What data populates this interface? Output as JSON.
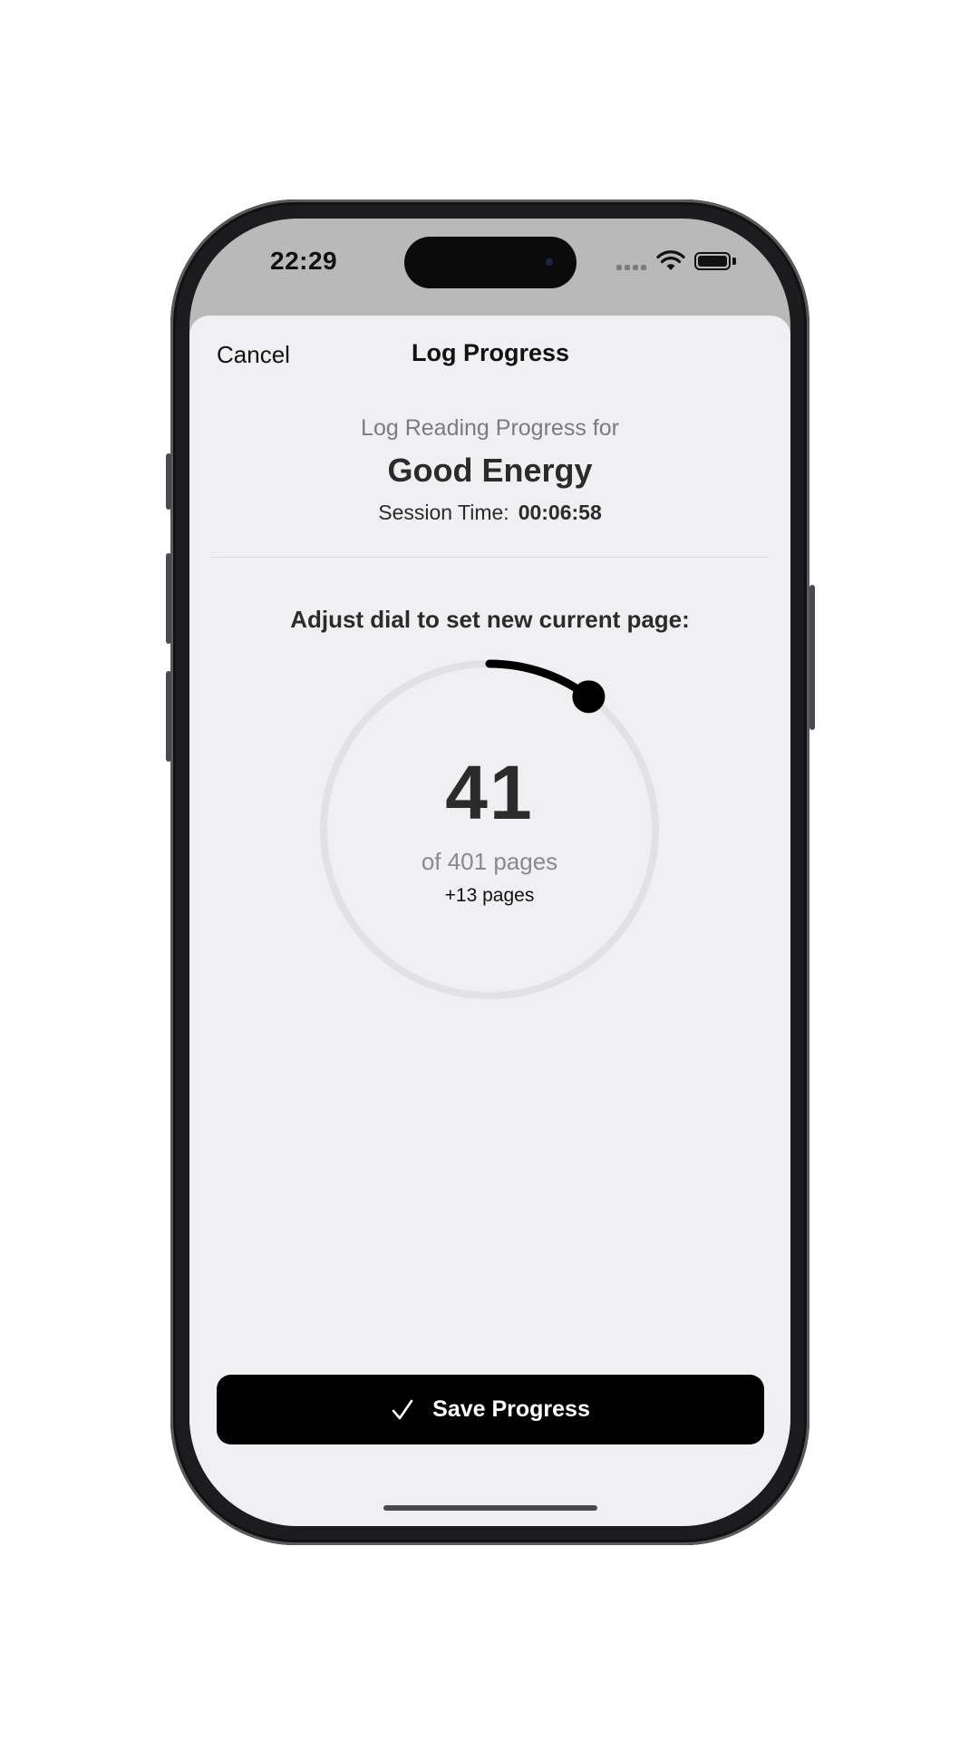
{
  "status_bar": {
    "time": "22:29",
    "icons": [
      "cellular-dots-icon",
      "wifi-icon",
      "battery-icon"
    ]
  },
  "nav": {
    "cancel_label": "Cancel",
    "title": "Log Progress"
  },
  "header": {
    "subtitle": "Log Reading Progress for",
    "book_title": "Good Energy",
    "session_label": "Session Time:",
    "session_value": "00:06:58"
  },
  "dial": {
    "instruction": "Adjust dial to set new current page:",
    "current_page": "41",
    "total_pages_text": "of 401 pages",
    "delta_text": "+13 pages",
    "progress_fraction": 0.102,
    "track_color": "#e2e2e4",
    "progress_color": "#000000"
  },
  "footer": {
    "save_label": "Save Progress",
    "save_icon": "checkmark-icon"
  },
  "colors": {
    "sheet_background": "#f0f0f2",
    "status_background": "#b8b9b8",
    "primary_button": "#000000"
  }
}
